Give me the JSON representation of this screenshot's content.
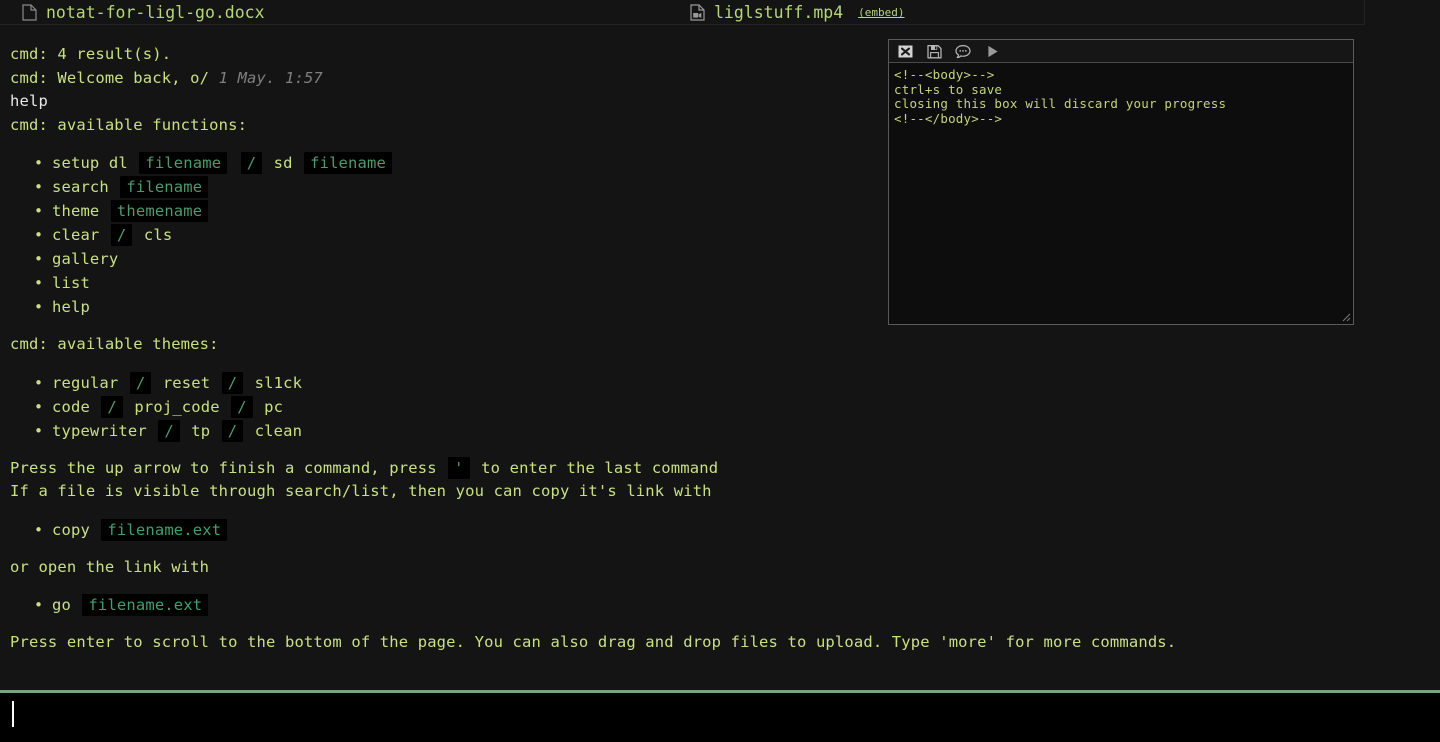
{
  "filebar": {
    "files": [
      {
        "icon": "document-file-icon",
        "name": "notat-for-ligl-go.docx",
        "link": null
      },
      {
        "icon": "video-file-icon",
        "name": "liglstuff.mp4",
        "link": "(embed)"
      }
    ]
  },
  "rail": {
    "add_icon": "plus-square-icon",
    "save_icon": "floppy-disk-icon",
    "checkbox_checked": true,
    "checkbox_color": "#1a73e8"
  },
  "terminal": {
    "line_results": "cmd: 4 result(s).",
    "welcome_prefix": "cmd: Welcome back, o/",
    "welcome_timestamp": "1 May. 1:57",
    "echo_help": "help",
    "line_functions": "cmd: available functions:",
    "functions": [
      {
        "parts": [
          {
            "t": "text",
            "v": "setup dl "
          },
          {
            "t": "code",
            "v": "filename"
          },
          {
            "t": "text",
            "v": " "
          },
          {
            "t": "code",
            "v": "/"
          },
          {
            "t": "text",
            "v": " sd "
          },
          {
            "t": "code",
            "v": "filename"
          }
        ]
      },
      {
        "parts": [
          {
            "t": "text",
            "v": "search "
          },
          {
            "t": "code",
            "v": "filename"
          }
        ]
      },
      {
        "parts": [
          {
            "t": "text",
            "v": "theme "
          },
          {
            "t": "code",
            "v": "themename"
          }
        ]
      },
      {
        "parts": [
          {
            "t": "text",
            "v": "clear "
          },
          {
            "t": "code",
            "v": "/"
          },
          {
            "t": "text",
            "v": " cls"
          }
        ]
      },
      {
        "parts": [
          {
            "t": "text",
            "v": "gallery"
          }
        ]
      },
      {
        "parts": [
          {
            "t": "text",
            "v": "list"
          }
        ]
      },
      {
        "parts": [
          {
            "t": "text",
            "v": "help"
          }
        ]
      }
    ],
    "line_themes": "cmd: available themes:",
    "themes": [
      {
        "parts": [
          {
            "t": "text",
            "v": "regular "
          },
          {
            "t": "code",
            "v": "/"
          },
          {
            "t": "text",
            "v": " reset "
          },
          {
            "t": "code",
            "v": "/"
          },
          {
            "t": "text",
            "v": " sl1ck"
          }
        ]
      },
      {
        "parts": [
          {
            "t": "text",
            "v": "code "
          },
          {
            "t": "code",
            "v": "/"
          },
          {
            "t": "text",
            "v": " proj_code "
          },
          {
            "t": "code",
            "v": "/"
          },
          {
            "t": "text",
            "v": " pc"
          }
        ]
      },
      {
        "parts": [
          {
            "t": "text",
            "v": "typewriter "
          },
          {
            "t": "code",
            "v": "/"
          },
          {
            "t": "text",
            "v": " tp "
          },
          {
            "t": "code",
            "v": "/"
          },
          {
            "t": "text",
            "v": " clean"
          }
        ]
      }
    ],
    "hint_uparrow_a": "Press the up arrow to finish a command, press",
    "hint_uparrow_key": "'",
    "hint_uparrow_b": "to enter the last command",
    "hint_copy": "If a file is visible through search/list, then you can copy it's link with",
    "copy_cmd": [
      {
        "parts": [
          {
            "t": "text",
            "v": "copy "
          },
          {
            "t": "codeb",
            "v": "filename.ext"
          }
        ]
      }
    ],
    "hint_open": "or open the link with",
    "go_cmd": [
      {
        "parts": [
          {
            "t": "text",
            "v": "go "
          },
          {
            "t": "codeb",
            "v": "filename.ext"
          }
        ]
      }
    ],
    "footer": "Press enter to scroll to the bottom of the page. You can also drag and drop files to upload. Type 'more' for more commands."
  },
  "editor": {
    "toolbar": [
      {
        "icon": "close-icon",
        "label": "close"
      },
      {
        "icon": "save-floppy-icon",
        "label": "save"
      },
      {
        "icon": "comment-bubble-icon",
        "label": "comment"
      },
      {
        "icon": "play-icon",
        "label": "run"
      }
    ],
    "content": "<!--<body>-->\nctrl+s to save\nclosing this box will discard your progress\n<!--</body>-->"
  },
  "prompt": {
    "value": "",
    "placeholder": ""
  },
  "colors": {
    "background": "#141414",
    "text_green": "#c8e084",
    "cmd_green": "#9fbf5c",
    "code_green": "#4e9a6a",
    "divider": "#7da37d",
    "accent_blue": "#1a73e8"
  }
}
